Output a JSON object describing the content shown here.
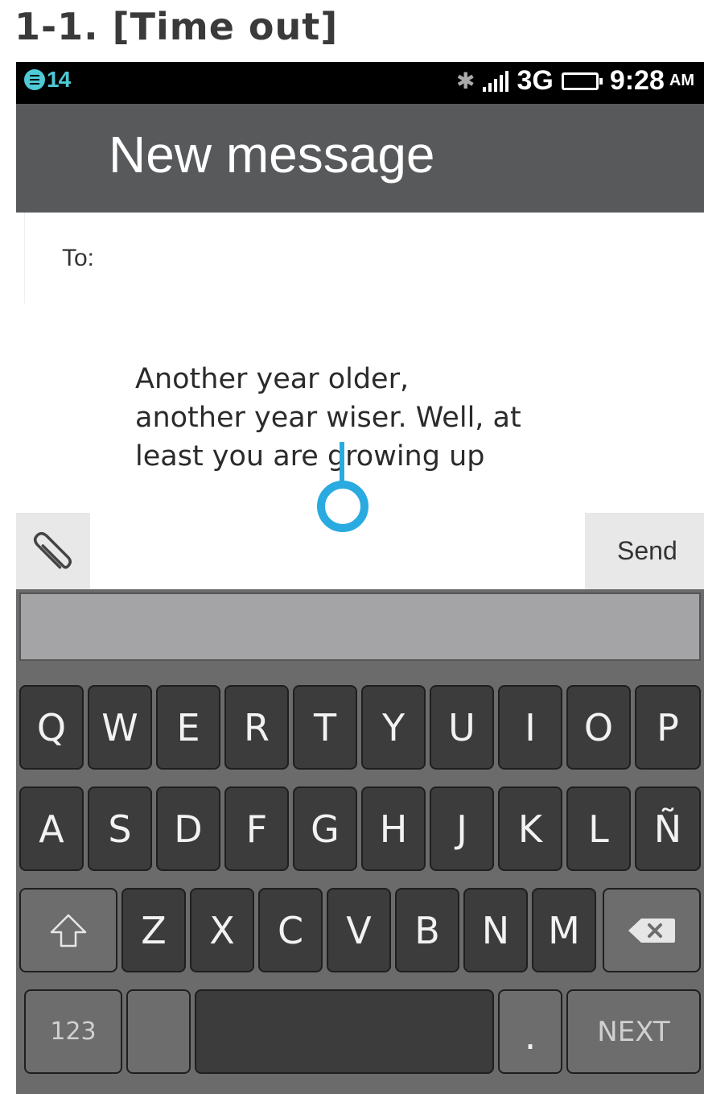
{
  "heading": "1-1. [Time out]",
  "status": {
    "notification_count": "14",
    "network": "3G",
    "time": "9:28",
    "ampm": "AM"
  },
  "header": {
    "title": "New message"
  },
  "recipient": {
    "label": "To:"
  },
  "message": {
    "line1": "Another year older,",
    "line2": "another year wiser. Well, at",
    "line3": "least you are growing up"
  },
  "actions": {
    "send_label": "Send"
  },
  "keyboard": {
    "row1": [
      "Q",
      "W",
      "E",
      "R",
      "T",
      "Y",
      "U",
      "I",
      "O",
      "P"
    ],
    "row2": [
      "A",
      "S",
      "D",
      "F",
      "G",
      "H",
      "J",
      "K",
      "L",
      "Ñ"
    ],
    "row3": [
      "Z",
      "X",
      "C",
      "V",
      "B",
      "N",
      "M"
    ],
    "num_label": "123",
    "period_label": ".",
    "next_label": "NEXT"
  }
}
